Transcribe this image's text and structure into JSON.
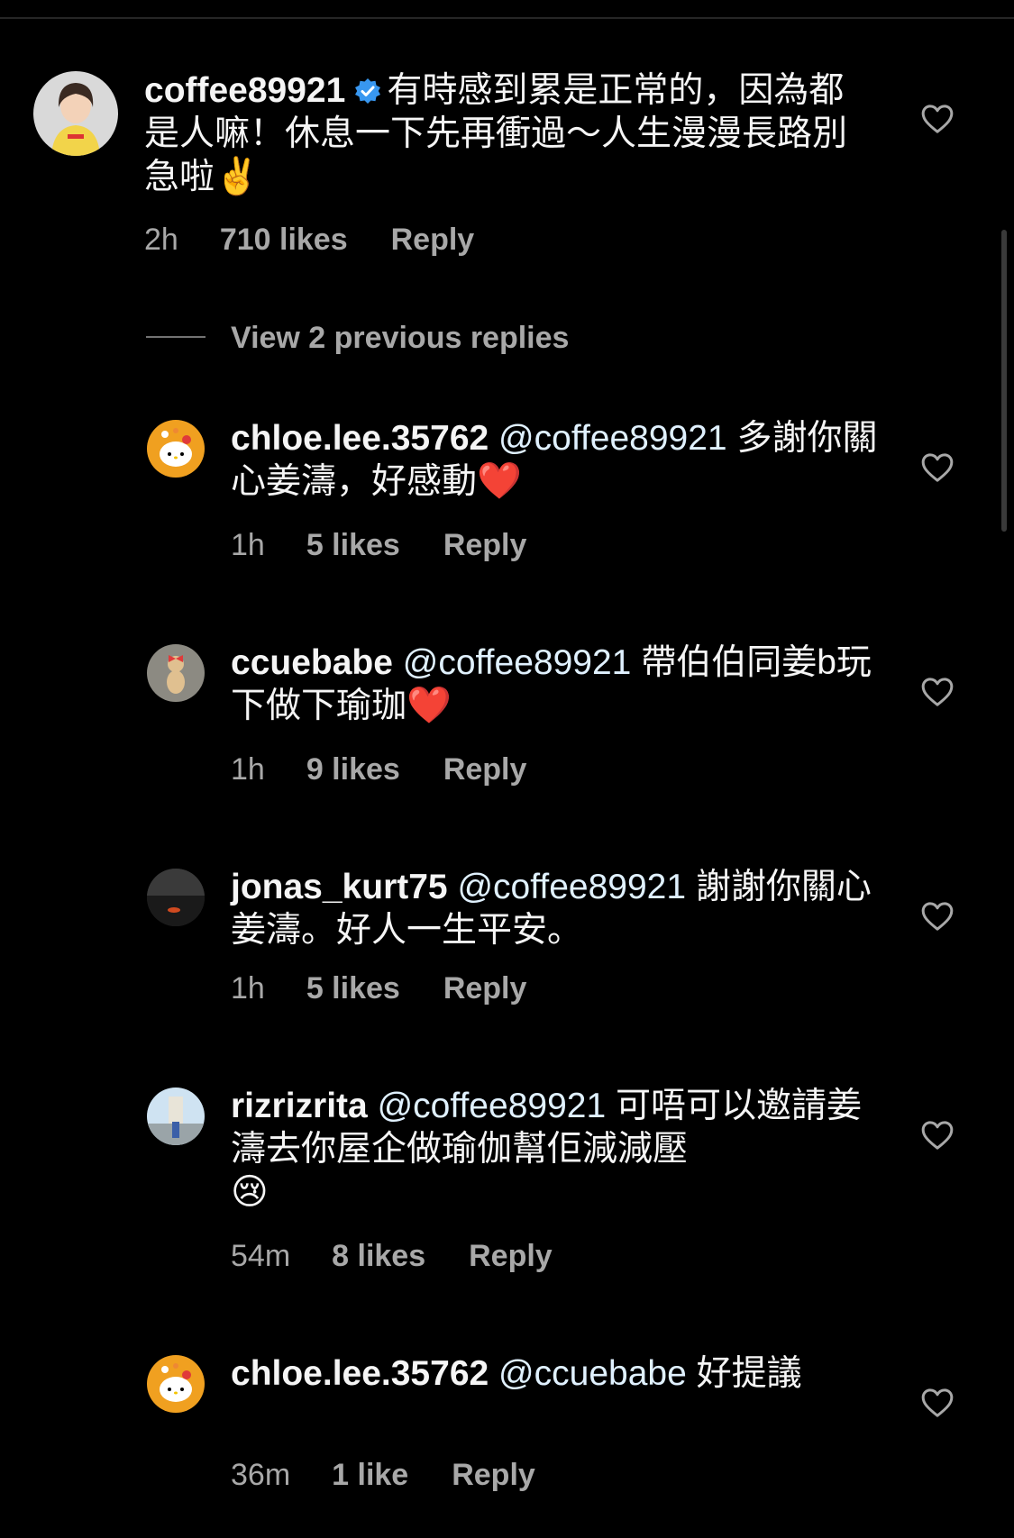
{
  "main_comment": {
    "username": "coffee89921",
    "verified": true,
    "text": "有時感到累是正常的，因為都是人嘛！休息一下先再衝過～人生漫漫長路別急啦",
    "emoji": "✌️",
    "time": "2h",
    "likes": "710 likes",
    "reply": "Reply"
  },
  "view_replies": "View 2 previous replies",
  "replies": [
    {
      "username": "chloe.lee.35762",
      "mention": "@coffee89921",
      "text": "多謝你關心姜濤，好感動",
      "emoji": "❤️",
      "time": "1h",
      "likes": "5 likes",
      "reply": "Reply"
    },
    {
      "username": "ccuebabe",
      "mention": "@coffee89921",
      "text": "帶伯伯同姜b玩下做下瑜珈",
      "emoji": "❤️",
      "time": "1h",
      "likes": "9 likes",
      "reply": "Reply"
    },
    {
      "username": "jonas_kurt75",
      "mention": "@coffee89921",
      "text": "謝謝你關心姜濤。好人一生平安。",
      "emoji": "",
      "time": "1h",
      "likes": "5 likes",
      "reply": "Reply"
    },
    {
      "username": "rizrizrita",
      "mention": "@coffee89921",
      "text": "可唔可以邀請姜濤去你屋企做瑜伽幫佢減減壓",
      "emoji": "😢",
      "time": "54m",
      "likes": "8 likes",
      "reply": "Reply"
    },
    {
      "username": "chloe.lee.35762",
      "mention": "@ccuebabe",
      "text": "好提議",
      "emoji": "",
      "time": "36m",
      "likes": "1 like",
      "reply": "Reply"
    }
  ],
  "icons": {
    "verified": "verified-badge-icon",
    "like": "heart-outline-icon"
  },
  "colors": {
    "background": "#000000",
    "text": "#f5f5f5",
    "secondary": "#a8a8a8",
    "verified": "#3897f0"
  }
}
